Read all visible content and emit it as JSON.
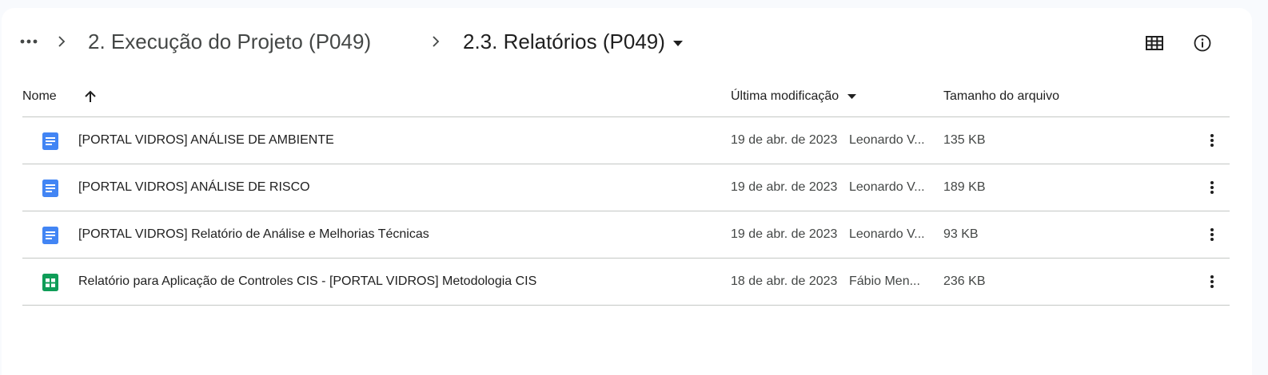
{
  "breadcrumb": {
    "more_icon": "more-horiz-icon",
    "items": [
      {
        "label": "2. Execução do Projeto (P049)"
      },
      {
        "label": "2.3. Relatórios (P049)"
      }
    ]
  },
  "toolbar": {
    "grid_view_icon": "grid-view-icon",
    "details_icon": "info-icon"
  },
  "table": {
    "columns": {
      "name": "Nome",
      "modified": "Última modificação",
      "size": "Tamanho do arquivo"
    },
    "sort": {
      "column": "Nome",
      "direction": "ascending"
    },
    "rows": [
      {
        "type": "document",
        "name": "[PORTAL VIDROS] ANÁLISE DE AMBIENTE",
        "date": "19 de abr. de 2023",
        "owner": "Leonardo V...",
        "size": "135 KB"
      },
      {
        "type": "document",
        "name": "[PORTAL VIDROS] ANÁLISE DE RISCO",
        "date": "19 de abr. de 2023",
        "owner": "Leonardo V...",
        "size": "189 KB"
      },
      {
        "type": "document",
        "name": "[PORTAL VIDROS] Relatório de Análise e Melhorias Técnicas",
        "date": "19 de abr. de 2023",
        "owner": "Leonardo V...",
        "size": "93 KB"
      },
      {
        "type": "spreadsheet",
        "name": "Relatório para Aplicação de Controles CIS - [PORTAL VIDROS] Metodologia CIS",
        "date": "18 de abr. de 2023",
        "owner": "Fábio Men...",
        "size": "236 KB"
      }
    ]
  },
  "colors": {
    "docs_blue": "#4285f4",
    "sheets_green": "#0f9d58",
    "text_primary": "#1f1f1f",
    "text_secondary": "#444746",
    "divider": "#c4c7c5"
  }
}
